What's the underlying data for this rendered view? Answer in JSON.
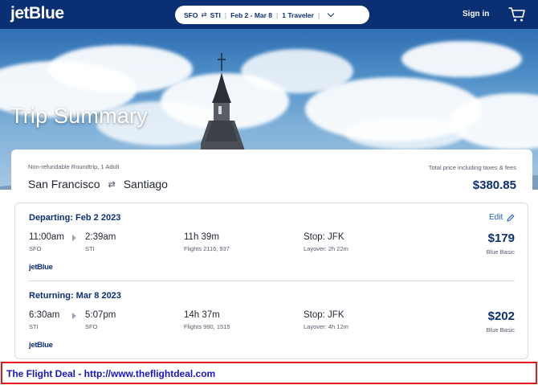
{
  "header": {
    "logo": "jetBlue",
    "search": {
      "origin": "SFO",
      "destination": "STI",
      "dates": "Feb 2 - Mar 8",
      "travelers": "1 Traveler"
    },
    "sign_in": "Sign in"
  },
  "hero": {
    "title": "Trip Summary"
  },
  "summary": {
    "trip_type": "Non-refundable Roundtrip, 1 Adult",
    "origin_city": "San Francisco",
    "destination_city": "Santiago",
    "total_label": "Total price including taxes & fees",
    "total_price": "$380.85"
  },
  "legs": [
    {
      "title": "Departing: Feb 2 2023",
      "depart_time": "11:00am",
      "depart_code": "SFO",
      "arrive_time": "2:39am",
      "arrive_code": "STI",
      "duration": "11h 39m",
      "flights": "Flights 2116, 937",
      "stop": "Stop: JFK",
      "layover": "Layover: 2h 22m",
      "price": "$179",
      "fare": "Blue Basic",
      "carrier": "jetBlue"
    },
    {
      "title": "Returning: Mar 8 2023",
      "depart_time": "6:30am",
      "depart_code": "STI",
      "arrive_time": "5:07pm",
      "arrive_code": "SFO",
      "duration": "14h 37m",
      "flights": "Flights 990, 1515",
      "stop": "Stop: JFK",
      "layover": "Layover: 4h 12m",
      "price": "$202",
      "fare": "Blue Basic",
      "carrier": "jetBlue"
    }
  ],
  "edit_label": "Edit",
  "banner": {
    "text": "The Flight Deal - http://www.theflightdeal.com"
  },
  "colors": {
    "brand_navy": "#0b2f73",
    "link_blue": "#1d5fbf",
    "banner_border": "#e11b1b",
    "banner_text": "#1616c8"
  },
  "icons": {
    "cart": "shopping-cart-icon",
    "swap": "swap-arrows-icon",
    "edit": "pencil-icon",
    "chevron": "chevron-down-icon",
    "leg_arrow": "play-arrow-icon"
  }
}
